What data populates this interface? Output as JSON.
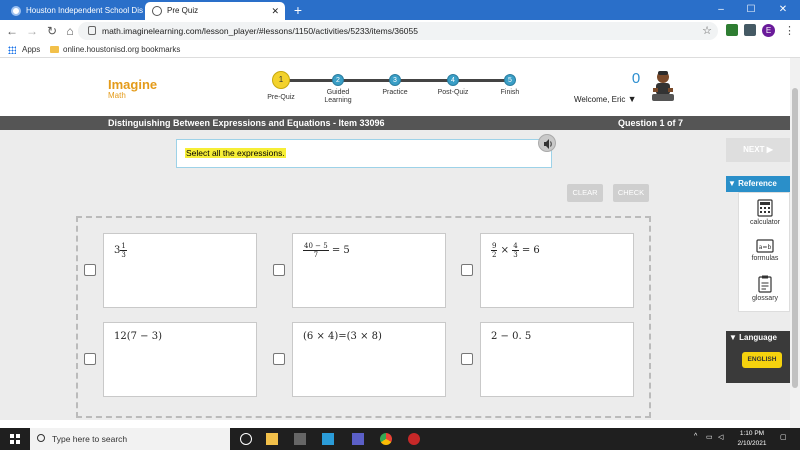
{
  "browser": {
    "tabs": [
      {
        "title": "Houston Independent School Dis",
        "active": false
      },
      {
        "title": "Pre Quiz",
        "active": true
      }
    ],
    "new_tab": "+",
    "url": "math.imaginelearning.com/lesson_player/#lessons/1150/activities/5233/items/36055",
    "profile_initial": "E",
    "win_controls": [
      "–",
      "☐",
      "✕"
    ],
    "bookmarks": {
      "apps": "Apps",
      "link": "online.houstonisd.org bookmarks"
    }
  },
  "header": {
    "brand_line1": "Imagine",
    "brand_line2": "Math",
    "steps": [
      {
        "number": "1",
        "label": "Pre-Quiz",
        "current": true
      },
      {
        "number": "2",
        "label": "Guided Learning",
        "current": false
      },
      {
        "number": "3",
        "label": "Practice",
        "current": false
      },
      {
        "number": "4",
        "label": "Post-Quiz",
        "current": false
      },
      {
        "number": "5",
        "label": "Finish",
        "current": false
      }
    ],
    "score": "0",
    "welcome": "Welcome, Eric",
    "welcome_arrow": "▼"
  },
  "titlebar": {
    "title": "Distinguishing Between Expressions and Equations - Item 33096",
    "question": "Question 1 of 7"
  },
  "question": {
    "prompt": "Select all the expressions.",
    "choices": [
      {
        "id": "a",
        "text": "3⅓",
        "checked": false
      },
      {
        "id": "b",
        "text": "(40 − 5)/7 = 5",
        "checked": false
      },
      {
        "id": "c",
        "text": "9/2 × 4/3 = 6",
        "checked": false
      },
      {
        "id": "d",
        "text": "12(7 − 3)",
        "checked": false
      },
      {
        "id": "e",
        "text": "(6 × 4)=(3 × 8)",
        "checked": false
      },
      {
        "id": "f",
        "text": "2 − 0. 5",
        "checked": false
      }
    ]
  },
  "controls": {
    "next": "NEXT ▶",
    "clear": "CLEAR",
    "check": "CHECK"
  },
  "sidebar": {
    "reference_label": "▼ Reference",
    "tools": [
      {
        "label": "calculator",
        "icon": "calculator-icon"
      },
      {
        "label": "formulas",
        "icon": "formulas-icon"
      },
      {
        "label": "glossary",
        "icon": "glossary-icon"
      }
    ],
    "language_label": "▼ Language",
    "language_button": "ENGLISH"
  },
  "taskbar": {
    "search_placeholder": "Type here to search",
    "time": "1:10 PM",
    "date": "2/10/2021"
  },
  "colors": {
    "chrome_blue": "#2a6fc9",
    "step_blue": "#3a9fc7",
    "step_current": "#f3d22c",
    "brand_orange": "#e49b1a",
    "titlebar_gray": "#555555",
    "highlight_yellow": "#f6ee36",
    "sidebar_blue": "#2a8fc9",
    "language_yellow": "#f5d20e"
  }
}
